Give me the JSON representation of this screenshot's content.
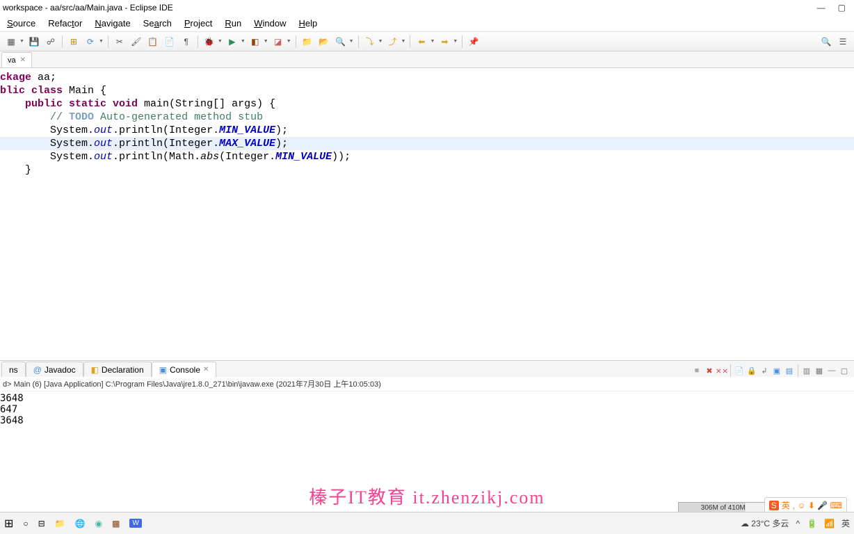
{
  "title": "workspace - aa/src/aa/Main.java - Eclipse IDE",
  "menu": {
    "source": "Source",
    "refactor": "Refactor",
    "navigate": "Navigate",
    "search": "Search",
    "project": "Project",
    "run": "Run",
    "window": "Window",
    "help": "Help"
  },
  "editor": {
    "tab_label": "va",
    "code": {
      "l1a": "ckage",
      "l1b": " aa;",
      "l2": "",
      "l3a": "blic",
      "l3b": " class",
      "l3c": " Main {",
      "l4": "",
      "l5a": "    public",
      "l5b": " static",
      "l5c": " void",
      "l5d": " main(String[] args) {",
      "l6a": "        // ",
      "l6b": "TODO",
      "l6c": " Auto-generated method stub",
      "l7": "",
      "l8a": "        System.",
      "l8b": "out",
      "l8c": ".println(Integer.",
      "l8d": "MIN_VALUE",
      "l8e": ");",
      "l9a": "        System.",
      "l9b": "out",
      "l9c": ".println(Integer.",
      "l9d": "MAX_VALUE",
      "l9e": ");",
      "l10a": "        System.",
      "l10b": "out",
      "l10c": ".println(Math.",
      "l10d": "abs",
      "l10e": "(Integer.",
      "l10f": "MIN_VALUE",
      "l10g": "));",
      "l11": "",
      "l12": "    }"
    }
  },
  "bottom": {
    "tab1": "ns",
    "tab2": "Javadoc",
    "tab3": "Declaration",
    "tab4": "Console"
  },
  "console": {
    "header": "d> Main (6) [Java Application] C:\\Program Files\\Java\\jre1.8.0_271\\bin\\javaw.exe (2021年7月30日 上午10:05:03)",
    "line1": "3648",
    "line2": "647",
    "line3": "3648"
  },
  "status": {
    "heap": "306M of 410M"
  },
  "watermark": "榛子IT教育  it.zhenzikj.com",
  "systray": {
    "weather": "23°C 多云",
    "ime": "英"
  }
}
